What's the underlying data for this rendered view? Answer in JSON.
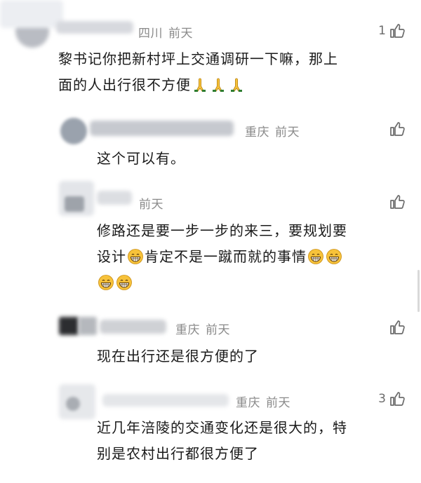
{
  "comments": [
    {
      "location": "四川",
      "time": "前天",
      "likes": "1",
      "lines": [
        "黎书记你把新村坪上交通调研一下嘛，那上",
        "面的人出行很不方便"
      ],
      "emoji": [
        "folded-hands",
        "folded-hands",
        "folded-hands"
      ]
    },
    {
      "location": "重庆",
      "time": "前天",
      "likes": "",
      "lines": [
        "这个可以有。"
      ]
    },
    {
      "location": "",
      "time": "前天",
      "likes": "",
      "lines": [
        "修路还是要一步一步的来三，要规划要",
        "设计",
        "肯定不是一蹴而就的事情"
      ],
      "emoji": [
        "grinning-face",
        "grinning-face",
        "grinning-face",
        "grinning-face",
        "grinning-face"
      ]
    },
    {
      "location": "重庆",
      "time": "前天",
      "likes": "",
      "lines": [
        "现在出行还是很方便的了"
      ]
    },
    {
      "location": "重庆",
      "time": "前天",
      "likes": "3",
      "lines": [
        "近几年涪陵的交通变化还是很大的，特",
        "别是农村出行都很方便了"
      ]
    }
  ],
  "icons": {
    "like": "thumbs-up-icon",
    "pray": "folded-hands-emoji",
    "grin": "grinning-face-emoji"
  },
  "colors": {
    "text": "#1a1a1a",
    "meta": "#8a8a8a",
    "icon": "#6b6b6b",
    "emoji_yellow": "#f7c23a"
  }
}
